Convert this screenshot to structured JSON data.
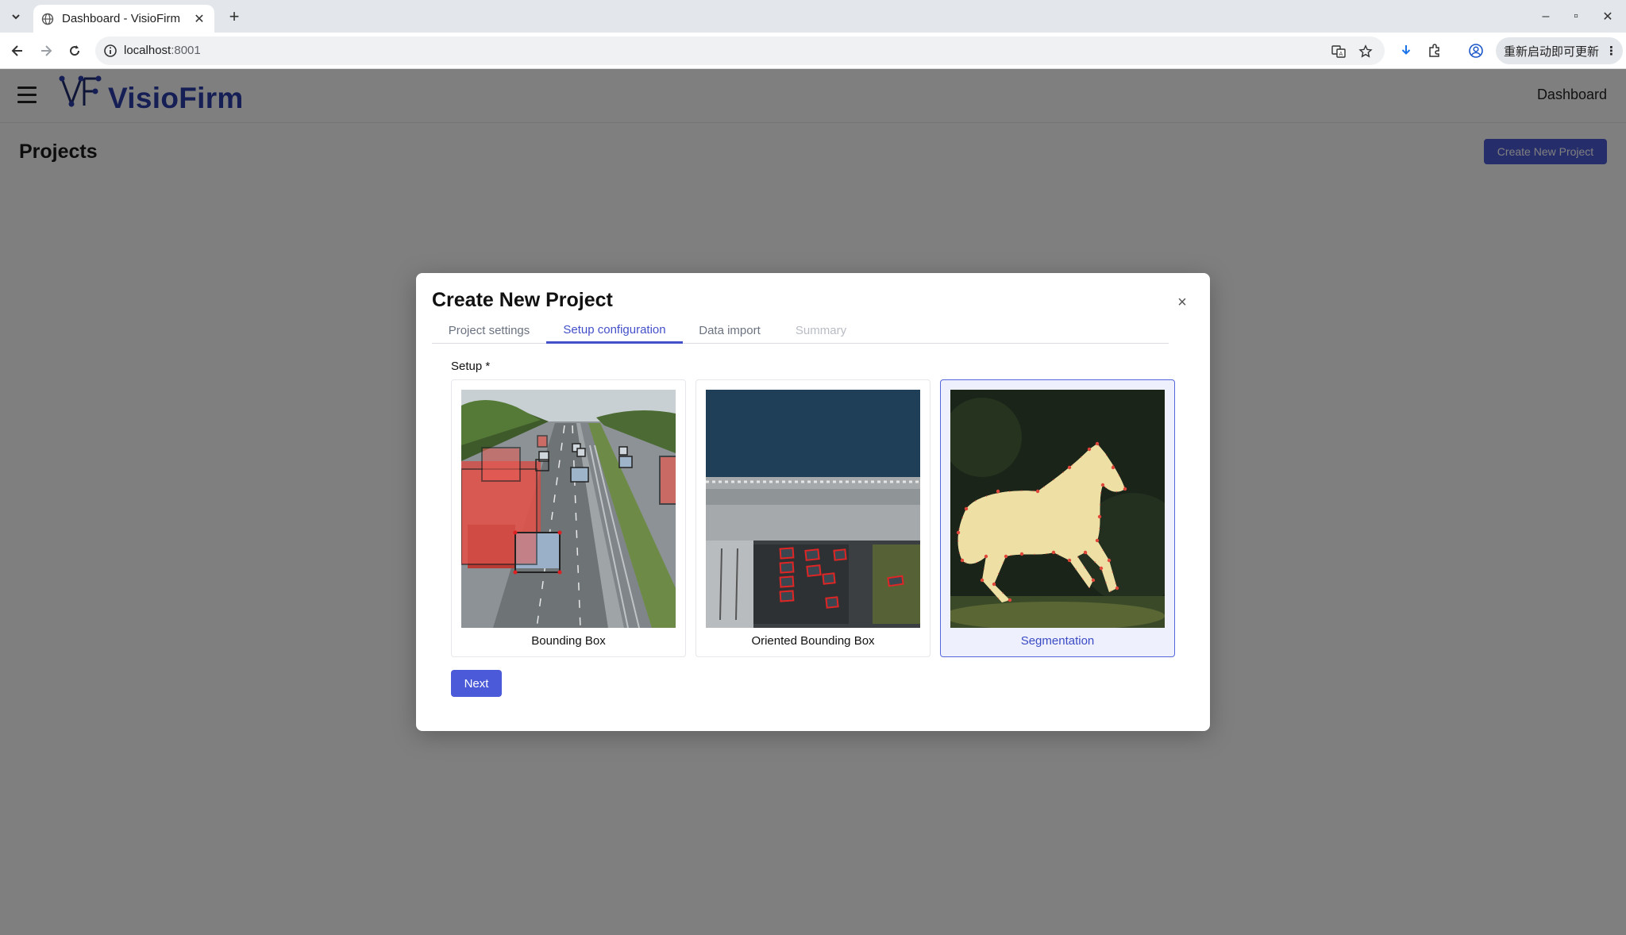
{
  "browser": {
    "tab_title": "Dashboard - VisioFirm",
    "url_host": "localhost",
    "url_port": ":8001",
    "update_label": "重新启动即可更新",
    "icons": [
      "tab-list-icon",
      "globe-icon",
      "close-icon",
      "plus-icon",
      "minimize-icon",
      "restore-icon",
      "close-icon",
      "back-icon",
      "forward-icon",
      "reload-icon",
      "info-icon",
      "translate-icon",
      "star-icon",
      "download-icon",
      "extensions-icon",
      "profile-icon",
      "more-icon"
    ]
  },
  "app": {
    "logo_text": "VisioFirm",
    "header_link": "Dashboard",
    "page_title": "Projects",
    "create_button": "Create New Project",
    "brand_color": "#2c3eaa",
    "accent_color": "#4a5ad8"
  },
  "modal": {
    "title": "Create New Project",
    "close_symbol": "×",
    "tabs": [
      {
        "label": "Project settings",
        "state": "inactive"
      },
      {
        "label": "Setup configuration",
        "state": "active"
      },
      {
        "label": "Data import",
        "state": "inactive"
      },
      {
        "label": "Summary",
        "state": "disabled"
      }
    ],
    "setup_label": "Setup *",
    "options": [
      {
        "label": "Bounding Box",
        "selected": false
      },
      {
        "label": "Oriented Bounding Box",
        "selected": false
      },
      {
        "label": "Segmentation",
        "selected": true
      }
    ],
    "next_button": "Next"
  }
}
